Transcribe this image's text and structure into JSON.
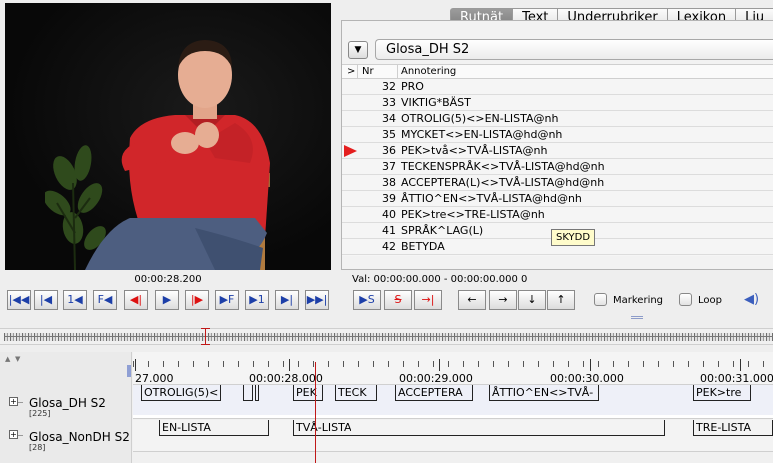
{
  "tabs": [
    {
      "label": "Rutnät",
      "active": true
    },
    {
      "label": "Text",
      "active": false
    },
    {
      "label": "Underrubriker",
      "active": false
    },
    {
      "label": "Lexikon",
      "active": false
    },
    {
      "label": "Lju",
      "active": false
    }
  ],
  "media": {
    "time": "00:00:28.200"
  },
  "annotation_panel": {
    "tier_selected": "Glosa_DH S2",
    "columns": {
      "marker": ">",
      "nr": "Nr",
      "annotation": "Annotering"
    },
    "rows": [
      {
        "nr": "32",
        "text": "PRO",
        "current": false
      },
      {
        "nr": "33",
        "text": "VIKTIG*BÄST",
        "current": false
      },
      {
        "nr": "34",
        "text": "OTROLIG(5)<>EN-LISTA@nh",
        "current": false
      },
      {
        "nr": "35",
        "text": "MYCKET<>EN-LISTA@hd@nh",
        "current": false
      },
      {
        "nr": "36",
        "text": "PEK>två<>TVÅ-LISTA@nh",
        "current": true
      },
      {
        "nr": "37",
        "text": "TECKENSPRÅK<>TVÅ-LISTA@hd@nh",
        "current": false
      },
      {
        "nr": "38",
        "text": "ACCEPTERA(L)<>TVÅ-LISTA@hd@nh",
        "current": false
      },
      {
        "nr": "39",
        "text": "ÅTTIO^EN<>TVÅ-LISTA@hd@nh",
        "current": false
      },
      {
        "nr": "40",
        "text": "PEK>tre<>TRE-LISTA@nh",
        "current": false
      },
      {
        "nr": "41",
        "text": "SPRÅK^LAG(L)",
        "current": false
      },
      {
        "nr": "42",
        "text": "BETYDA",
        "current": false
      }
    ],
    "tooltip": "SKYDD"
  },
  "selection": {
    "text": "Val: 00:00:00.000 - 00:00:00.000  0"
  },
  "player_buttons": [
    {
      "name": "go-to-start",
      "label": "|◀◀"
    },
    {
      "name": "previous-scrollview",
      "label": "|◀"
    },
    {
      "name": "previous-second",
      "label": "1◀"
    },
    {
      "name": "previous-frame",
      "label": "F◀"
    },
    {
      "name": "previous-pixel",
      "label": "◀|"
    },
    {
      "name": "play",
      "label": "▶"
    },
    {
      "name": "next-pixel",
      "label": "|▶"
    },
    {
      "name": "next-frame",
      "label": "▶F"
    },
    {
      "name": "next-second",
      "label": "▶1"
    },
    {
      "name": "next-scrollview",
      "label": "▶|"
    },
    {
      "name": "go-to-end",
      "label": "▶▶|"
    }
  ],
  "selection_buttons": [
    {
      "name": "play-selection",
      "label": "▶S"
    },
    {
      "name": "clear-selection",
      "label": "S"
    },
    {
      "name": "toggle-selection-mode",
      "label": "→|"
    }
  ],
  "nav_buttons": [
    {
      "name": "prev-annotation",
      "label": "←"
    },
    {
      "name": "next-annotation",
      "label": "→"
    },
    {
      "name": "tier-down",
      "label": "↓"
    },
    {
      "name": "tier-up",
      "label": "↑"
    }
  ],
  "options": {
    "markering": "Markering",
    "loop": "Loop"
  },
  "timeline": {
    "ticks": [
      "27.000",
      "00:00:28.000",
      "00:00:29.000",
      "00:00:30.000",
      "00:00:31.000"
    ],
    "tiers": [
      {
        "name": "Glosa_DH S2",
        "count": "[225]",
        "segments": [
          {
            "label": "OTROLIG(5)<"
          },
          {
            "label": ""
          },
          {
            "label": ""
          },
          {
            "label": "PEK"
          },
          {
            "label": "TECK"
          },
          {
            "label": "ACCEPTERA"
          },
          {
            "label": "ÅTTIO^EN<>TVÅ-"
          },
          {
            "label": "PEK>tre"
          }
        ]
      },
      {
        "name": "Glosa_NonDH S2",
        "count": "[28]",
        "segments": [
          {
            "label": "EN-LISTA"
          },
          {
            "label": "TVÅ-LISTA"
          },
          {
            "label": "TRE-LISTA"
          }
        ]
      }
    ]
  },
  "colors": {
    "accent": "#e41e1e",
    "cursor": "#c01818",
    "tab_active": "#8a8a8a",
    "tooltip_bg": "#fffccb"
  }
}
